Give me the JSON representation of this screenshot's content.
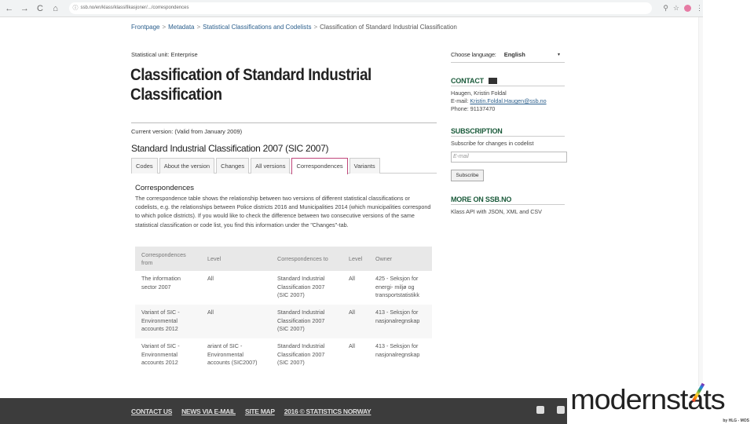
{
  "browser": {
    "url": "ssb.no/en/klass/klassifikasjoner/.../correspondences",
    "back": "←",
    "forward": "→",
    "reload": "C",
    "home": "⌂",
    "zoom_icon": "⚲",
    "star_icon": "☆",
    "menu_icon": "⋮"
  },
  "breadcrumb": {
    "items": [
      "Frontpage",
      "Metadata",
      "Statistical Classifications and Codelists"
    ],
    "separator": ">",
    "current": "Classification of Standard Industrial Classification"
  },
  "stat_unit": {
    "label": "Statistical unit:",
    "value": "Enterprise"
  },
  "page_title": "Classification of Standard Industrial Classification",
  "current_version": "Current version: (Valid from January 2009)",
  "version_title": "Standard Industrial Classification 2007 (SIC 2007)",
  "tabs": [
    {
      "label": "Codes"
    },
    {
      "label": "About the version"
    },
    {
      "label": "Changes"
    },
    {
      "label": "All versions"
    },
    {
      "label": "Correspondences"
    },
    {
      "label": "Variants"
    }
  ],
  "correspondences": {
    "heading": "Correspondences",
    "description": "The correspondence table shows the relationship between two versions of different statistical classifications or codelists, e.g. the relationships between Police districts 2016 and Municipalities 2014 (which municipalities correspond to which police districts). If you would like to check the difference between two consecutive versions of the same statistical classification or code list, you find this information under the \"Changes\"-tab.",
    "columns": [
      "Correspondences from",
      "Level",
      "Correspondences to",
      "Level",
      "Owner"
    ],
    "rows": [
      {
        "from": "The information sector 2007",
        "level1": "All",
        "to": "Standard Industrial Classification 2007 (SIC 2007)",
        "level2": "All",
        "owner": "425 - Seksjon for energi- miljø og transportstatistikk"
      },
      {
        "from": "Variant of SIC - Environmental accounts 2012",
        "level1": "All",
        "to": "Standard Industrial Classification 2007 (SIC 2007)",
        "level2": "All",
        "owner": "413 - Seksjon for nasjonalregnskap"
      },
      {
        "from": "Variant of SIC - Environmental accounts 2012",
        "level1": "ariant of SIC - Environmental accounts (SIC2007)",
        "to": "Standard Industrial Classification 2007 (SIC 2007)",
        "level2": "All",
        "owner": "413 - Seksjon for nasjonalregnskap"
      }
    ]
  },
  "sidebar": {
    "language_label": "Choose language:",
    "language_value": "English",
    "caret": "▾",
    "contact_heading": "CONTACT",
    "contact_name": "Haugen, Kristin Foldal",
    "contact_email_label": "E-mail:",
    "contact_email": "Kristin.Foldal.Haugen@ssb.no",
    "contact_phone": "Phone: 91137470",
    "subscription_heading": "SUBSCRIPTION",
    "subscription_text": "Subscribe for changes in codelist",
    "email_placeholder": "E-mail",
    "subscribe_label": "Subscribe",
    "more_heading": "MORE ON SSB.NO",
    "more_text": "Klass API with JSON, XML and CSV"
  },
  "footer": {
    "links": [
      "CONTACT US",
      "NEWS VIA E-MAIL",
      "SITE MAP",
      "2016 © STATISTICS NORWAY"
    ]
  },
  "logo": {
    "wordmark": "modernstats",
    "byline": "by HLG - MOS"
  }
}
